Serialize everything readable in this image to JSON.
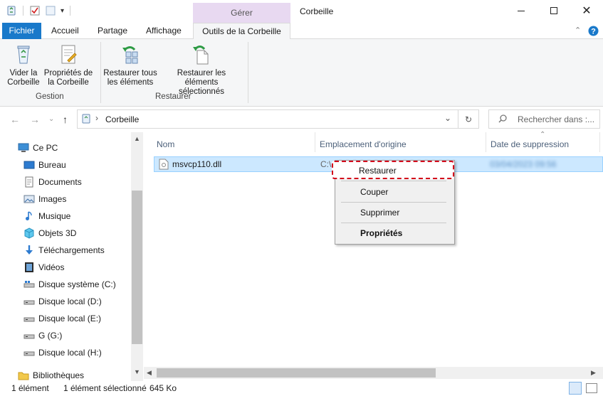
{
  "window": {
    "title": "Corbeille",
    "context_tab_group": "Gérer"
  },
  "tabs": {
    "file": "Fichier",
    "home": "Accueil",
    "share": "Partage",
    "view": "Affichage",
    "recycle_tools": "Outils de la Corbeille"
  },
  "ribbon": {
    "empty": [
      "Vider la",
      "Corbeille"
    ],
    "properties": [
      "Propriétés de",
      "la Corbeille"
    ],
    "restore_all": [
      "Restaurer tous",
      "les éléments"
    ],
    "restore_selected": [
      "Restaurer les éléments",
      "sélectionnés"
    ],
    "group_manage": "Gestion",
    "group_restore": "Restaurer"
  },
  "address": {
    "path": "Corbeille",
    "search_placeholder": "Rechercher dans :..."
  },
  "nav": {
    "items": [
      {
        "label": "Ce PC",
        "icon": "pc-icon"
      },
      {
        "label": "Bureau",
        "icon": "desktop-icon"
      },
      {
        "label": "Documents",
        "icon": "documents-icon"
      },
      {
        "label": "Images",
        "icon": "images-icon"
      },
      {
        "label": "Musique",
        "icon": "music-icon"
      },
      {
        "label": "Objets 3D",
        "icon": "objects-3d-icon"
      },
      {
        "label": "Téléchargements",
        "icon": "downloads-icon"
      },
      {
        "label": "Vidéos",
        "icon": "videos-icon"
      },
      {
        "label": "Disque système (C:)",
        "icon": "system-drive-icon"
      },
      {
        "label": "Disque local (D:)",
        "icon": "drive-icon"
      },
      {
        "label": "Disque local (E:)",
        "icon": "drive-icon"
      },
      {
        "label": "G (G:)",
        "icon": "drive-icon"
      },
      {
        "label": "Disque local (H:)",
        "icon": "drive-icon"
      },
      {
        "label": "Bibliothèques",
        "icon": "libraries-icon"
      }
    ]
  },
  "columns": {
    "name": "Nom",
    "origin": "Emplacement d'origine",
    "date_deleted": "Date de suppression"
  },
  "file": {
    "name": "msvcp110.dll",
    "origin_visible": "C:\\",
    "date_deleted_blurred": "03/04/2023 09:56"
  },
  "context_menu": {
    "restore": "Restaurer",
    "cut": "Couper",
    "delete": "Supprimer",
    "properties": "Propriétés"
  },
  "status": {
    "count": "1 élément",
    "selected": "1 élément sélectionné",
    "size": "645 Ko"
  },
  "colors": {
    "file_tab": "#1979ca",
    "context_tab": "#e8d9f1",
    "selection": "#cce8ff",
    "highlight_border": "#d3001a"
  }
}
